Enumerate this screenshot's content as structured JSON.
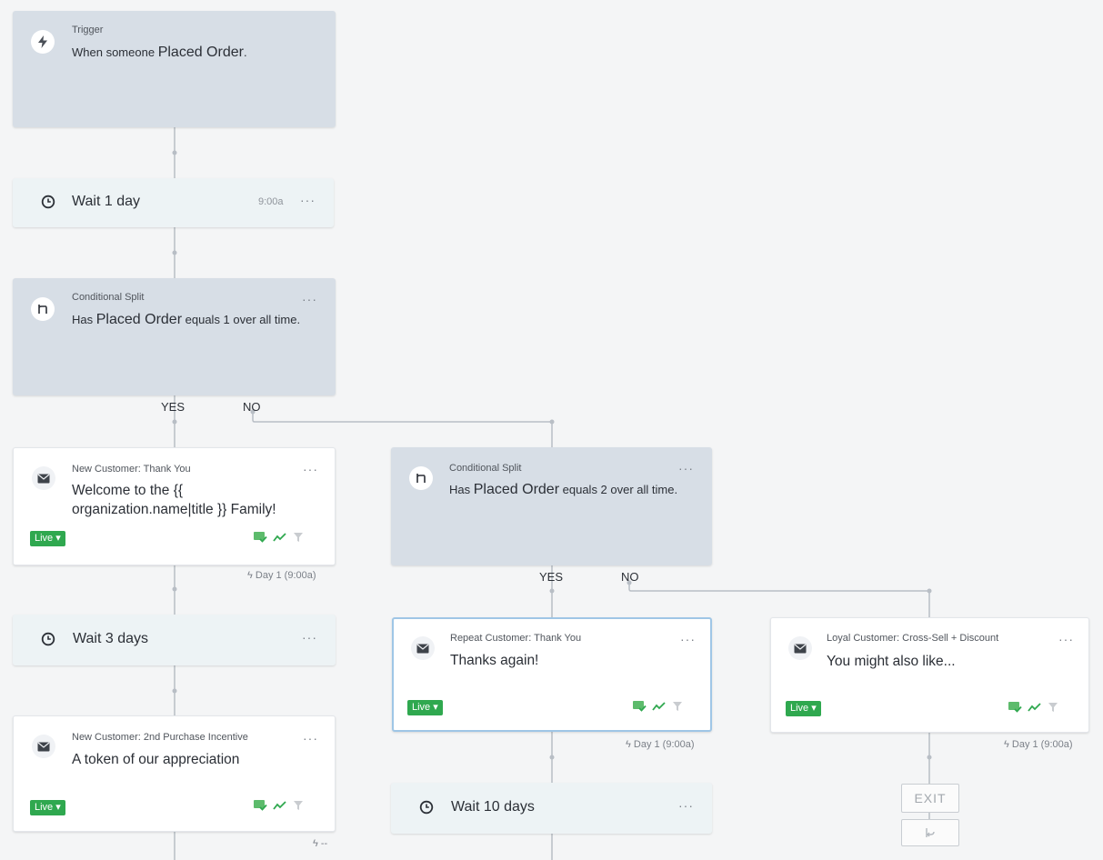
{
  "trigger": {
    "label": "Trigger",
    "prefix": "When someone",
    "event": "Placed Order",
    "suffix": "."
  },
  "wait1": {
    "label": "Wait 1 day",
    "time": "9:00a"
  },
  "split1": {
    "label": "Conditional Split",
    "has": "Has",
    "metric": "Placed Order",
    "rest": "equals 1 over all time."
  },
  "branch1": {
    "yes": "YES",
    "no": "NO"
  },
  "email_new1": {
    "name": "New Customer: Thank You",
    "subject": "Welcome to the {{ organization.name|title }} Family!",
    "status": "Live ▾",
    "footer": "Day 1 (9:00a)"
  },
  "split2": {
    "label": "Conditional Split",
    "has": "Has",
    "metric": "Placed Order",
    "rest": "equals 2 over all time."
  },
  "branch2": {
    "yes": "YES",
    "no": "NO"
  },
  "wait3": {
    "label": "Wait 3 days"
  },
  "email_repeat": {
    "name": "Repeat Customer: Thank You",
    "subject": "Thanks again!",
    "status": "Live ▾",
    "footer": "Day 1 (9:00a)"
  },
  "email_loyal": {
    "name": "Loyal Customer: Cross-Sell + Discount",
    "subject": "You might also like...",
    "status": "Live ▾",
    "footer": "Day 1 (9:00a)"
  },
  "email_new2": {
    "name": "New Customer: 2nd Purchase Incentive",
    "subject": "A token of our appreciation",
    "status": "Live ▾",
    "footer": "--"
  },
  "wait10": {
    "label": "Wait 10 days"
  },
  "exit": {
    "label": "EXIT"
  },
  "menu": {
    "dots": "···"
  },
  "colors": {
    "live": "#2fa84f",
    "trigger_bg": "#d7dee6",
    "wait_bg": "#edf3f5",
    "connector": "#b8bec5",
    "selected_border": "#9fc6e6"
  },
  "icons": [
    "bolt-icon",
    "clock-icon",
    "split-icon",
    "mail-icon",
    "message-sent-icon",
    "analytics-icon",
    "filter-icon",
    "exit-icon"
  ]
}
